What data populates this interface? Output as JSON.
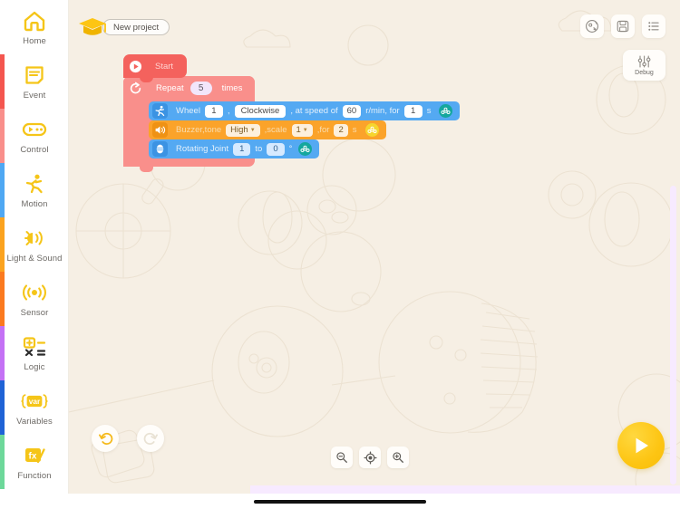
{
  "sidebar": {
    "items": [
      {
        "label": "Home",
        "icon": "home-icon",
        "strip": ""
      },
      {
        "label": "Event",
        "icon": "event-icon",
        "strip": "#f4564f"
      },
      {
        "label": "Control",
        "icon": "control-icon",
        "strip": "#f98f8b"
      },
      {
        "label": "Motion",
        "icon": "motion-icon",
        "strip": "#4fa8f3"
      },
      {
        "label": "Light & Sound",
        "icon": "light-sound-icon",
        "strip": "#fba31f"
      },
      {
        "label": "Sensor",
        "icon": "sensor-icon",
        "strip": "#fb7a1f"
      },
      {
        "label": "Logic",
        "icon": "logic-icon",
        "strip": "#c471f5"
      },
      {
        "label": "Variables",
        "icon": "variables-icon",
        "strip": "#1f63d6"
      },
      {
        "label": "Function",
        "icon": "function-icon",
        "strip": "#6dd89a"
      }
    ]
  },
  "header": {
    "project_name": "New project",
    "cap_icon": "graduation-cap-icon",
    "tools": [
      {
        "name": "robot-preview-icon",
        "title": "Robot"
      },
      {
        "name": "save-icon",
        "title": "Save"
      },
      {
        "name": "list-icon",
        "title": "Blocks list"
      }
    ],
    "debug": {
      "label": "Debug",
      "icon": "sliders-icon"
    }
  },
  "script": {
    "start": {
      "label": "Start",
      "icon": "play-circle-icon"
    },
    "repeat": {
      "icon": "loop-icon",
      "label_before": "Repeat",
      "count": "5",
      "label_after": "times"
    },
    "blocks": [
      {
        "type": "wheel",
        "icon": "motion-run-icon",
        "color": "#54a9f2",
        "t1": "Wheel",
        "v1": "1",
        "t2": ",",
        "dir": "Clockwise",
        "t3": ", at speed of",
        "speed": "60",
        "t4": "r/min, for",
        "dur": "1",
        "t5": "s",
        "badge": "cloud-icon"
      },
      {
        "type": "buzzer",
        "icon": "speaker-icon",
        "color": "#fba32a",
        "t1": "Buzzer,tone",
        "tone": "High",
        "t2": ",scale",
        "scale": "1",
        "t3": ",for",
        "dur": "2",
        "t4": "s",
        "badge": "cloud-icon"
      },
      {
        "type": "rotating-joint",
        "icon": "joint-icon",
        "color": "#54a9f2",
        "t1": "Rotating Joint",
        "v1": "1",
        "t2": "to",
        "v2": "0",
        "t3": "°",
        "badge": "cloud-icon"
      }
    ]
  },
  "bottom": {
    "undo": "undo-icon",
    "redo": "redo-icon",
    "zoom_out": "zoom-out-icon",
    "center": "center-target-icon",
    "zoom_in": "zoom-in-icon",
    "run": "run-play-icon"
  },
  "colors": {
    "canvas_bg": "#f6efe4",
    "start": "#f4625d",
    "repeat": "#f98f8b",
    "motion": "#54a9f2",
    "sound": "#fba32a",
    "accent_yellow": "#fdc513"
  }
}
